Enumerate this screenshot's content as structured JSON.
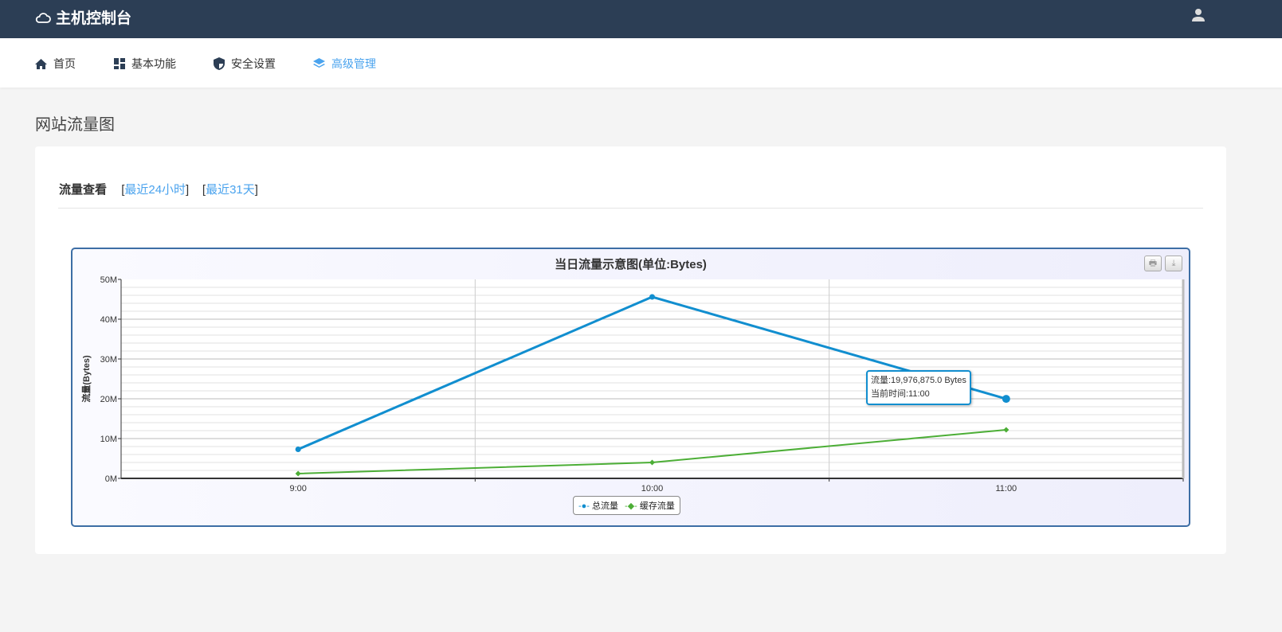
{
  "header": {
    "title": "主机控制台"
  },
  "nav": [
    {
      "label": "首页",
      "icon": "home-icon"
    },
    {
      "label": "基本功能",
      "icon": "dashboard-icon"
    },
    {
      "label": "安全设置",
      "icon": "shield-icon"
    },
    {
      "label": "高级管理",
      "icon": "layers-icon",
      "active": true
    }
  ],
  "page_title": "网站流量图",
  "tabs": {
    "label": "流量查看",
    "links": [
      "最近24小时",
      "最近31天"
    ]
  },
  "tooltip": {
    "line1": "流量:19,976,875.0 Bytes",
    "line2": "当前时间:11:00"
  },
  "chart_data": {
    "type": "line",
    "title": "当日流量示意图(单位:Bytes)",
    "ylabel": "流量(Bytes)",
    "xlabel": "",
    "categories": [
      "9:00",
      "10:00",
      "11:00"
    ],
    "yticks": [
      "0M",
      "10M",
      "20M",
      "30M",
      "40M",
      "50M"
    ],
    "ylim": [
      0,
      50000000
    ],
    "series": [
      {
        "name": "总流量",
        "color": "#118ecf",
        "values": [
          7300000,
          45600000,
          19976875
        ]
      },
      {
        "name": "缓存流量",
        "color": "#4cae36",
        "values": [
          1200000,
          4000000,
          12200000
        ]
      }
    ],
    "legend": "bottom-center"
  }
}
